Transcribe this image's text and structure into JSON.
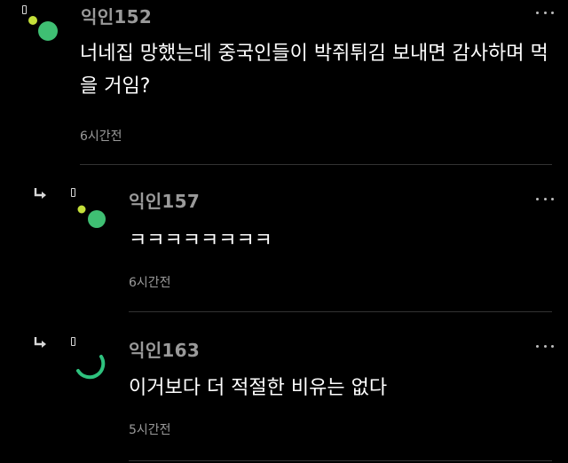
{
  "comments": [
    {
      "author": "익인152",
      "text": "너네집 망했는데 중국인들이 박쥐튀김 보내면 감사하며 먹을 거임?",
      "time": "6시간전"
    },
    {
      "author": "익인157",
      "text": "ㅋㅋㅋㅋㅋㅋㅋㅋ",
      "time": "6시간전"
    },
    {
      "author": "익인163",
      "text": "이거보다 더 적절한 비유는 없다",
      "time": "5시간전"
    }
  ],
  "colors": {
    "background": "#000000",
    "author": "#9a9a9a",
    "text": "#ffffff",
    "avatar_green": "#3fbf73",
    "avatar_lime": "#c4e03a",
    "divider": "#333333"
  }
}
